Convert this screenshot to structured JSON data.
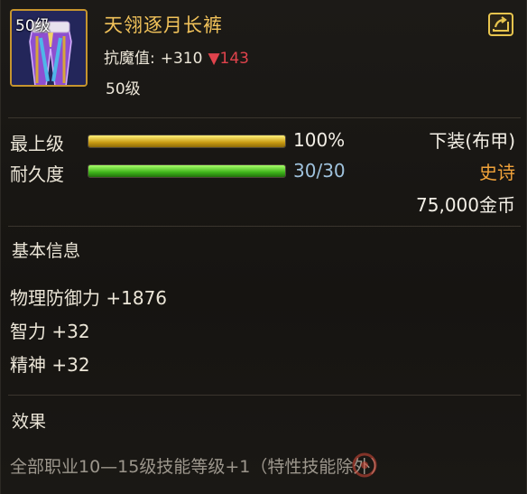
{
  "item": {
    "name": "天翎逐月长裤",
    "icon_level": "50级",
    "resist_label": "抗魔值:",
    "resist_value": "+310",
    "resist_diff": "▼143",
    "level_text": "50级",
    "icon": "purple-pants-icon"
  },
  "stats": [
    {
      "label": "最上级",
      "value": "100%",
      "fill": 1.0,
      "color": "#e8c02a"
    },
    {
      "label": "耐久度",
      "value": "30/30",
      "fill": 1.0,
      "color": "#5fd42a"
    }
  ],
  "meta": {
    "type": "下装(布甲)",
    "rarity": "史诗",
    "price": "75,000金币",
    "rarity_color": "#f0a23a"
  },
  "basic_info": {
    "title": "基本信息",
    "attributes": [
      "物理防御力 +1876",
      "智力 +32",
      "精神 +32"
    ]
  },
  "effect": {
    "title": "效果",
    "text": "全部职业10—15级技能等级+1（特性技能除外）"
  },
  "watermark": {
    "text": "游戏网"
  }
}
